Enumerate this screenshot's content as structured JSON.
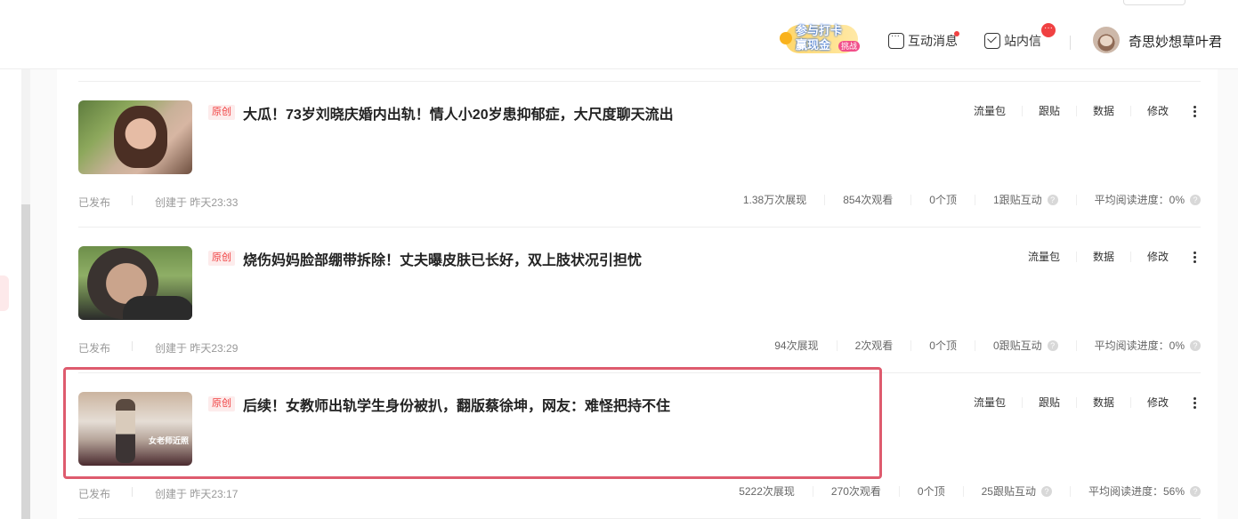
{
  "header": {
    "promo": {
      "line1": "参与打卡",
      "line2": "赢现金",
      "tag": "挑战"
    },
    "interaction_label": "互动消息",
    "inbox_label": "站内信",
    "inbox_badge": "···",
    "username": "奇思妙想草叶君"
  },
  "articles": [
    {
      "badge": "原创",
      "title": "大瓜！73岁刘晓庆婚内出轨！情人小20岁患抑郁症，大尺度聊天流出",
      "ops": [
        "流量包",
        "跟贴",
        "数据",
        "修改"
      ],
      "status": "已发布",
      "created": "创建于  昨天23:33",
      "stats": [
        "1.38万次展现",
        "854次观看",
        "0个顶",
        "1跟贴互动",
        "平均阅读进度：0%"
      ]
    },
    {
      "badge": "原创",
      "title": "烧伤妈妈脸部绷带拆除！丈夫曝皮肤已长好，双上肢状况引担忧",
      "ops": [
        "流量包",
        "数据",
        "修改"
      ],
      "status": "已发布",
      "created": "创建于  昨天23:29",
      "stats": [
        "94次展现",
        "2次观看",
        "0个顶",
        "0跟贴互动",
        "平均阅读进度：0%"
      ]
    },
    {
      "badge": "原创",
      "title": "后续！女教师出轨学生身份被扒，翻版蔡徐坤，网友：难怪把持不住",
      "thumb_caption": "女老师近照",
      "ops": [
        "流量包",
        "跟贴",
        "数据",
        "修改"
      ],
      "status": "已发布",
      "created": "创建于  昨天23:17",
      "stats": [
        "5222次展现",
        "270次观看",
        "0个顶",
        "25跟贴互动",
        "平均阅读进度：56%"
      ]
    }
  ],
  "colors": {
    "accent_red": "#f04142",
    "highlight": "#de5b6e"
  }
}
